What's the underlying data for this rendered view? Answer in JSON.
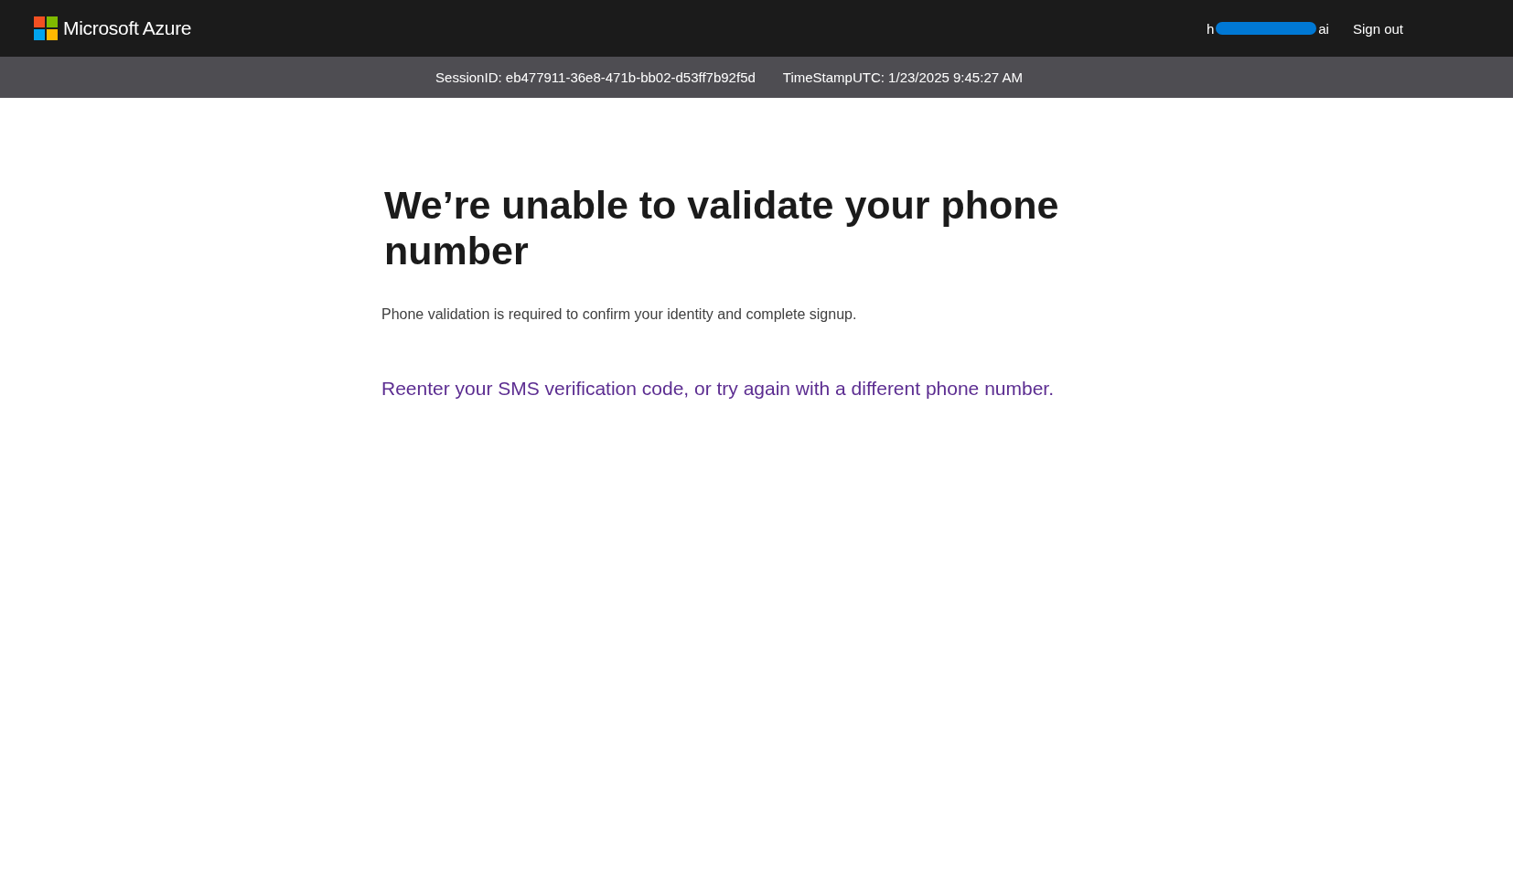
{
  "header": {
    "brand": "Microsoft Azure",
    "account": {
      "visible_start": "h",
      "visible_end": "ai",
      "redacted": true
    },
    "sign_out": "Sign out"
  },
  "session_bar": {
    "session_id": "SessionID: eb477911-36e8-471b-bb02-d53ff7b92f5d",
    "timestamp": "TimeStampUTC: 1/23/2025 9:45:27 AM"
  },
  "main": {
    "heading": "We’re unable to validate your phone number",
    "description": "Phone validation is required to confirm your identity and complete signup.",
    "link": "Reenter your SMS verification code, or try again with a different phone number."
  }
}
